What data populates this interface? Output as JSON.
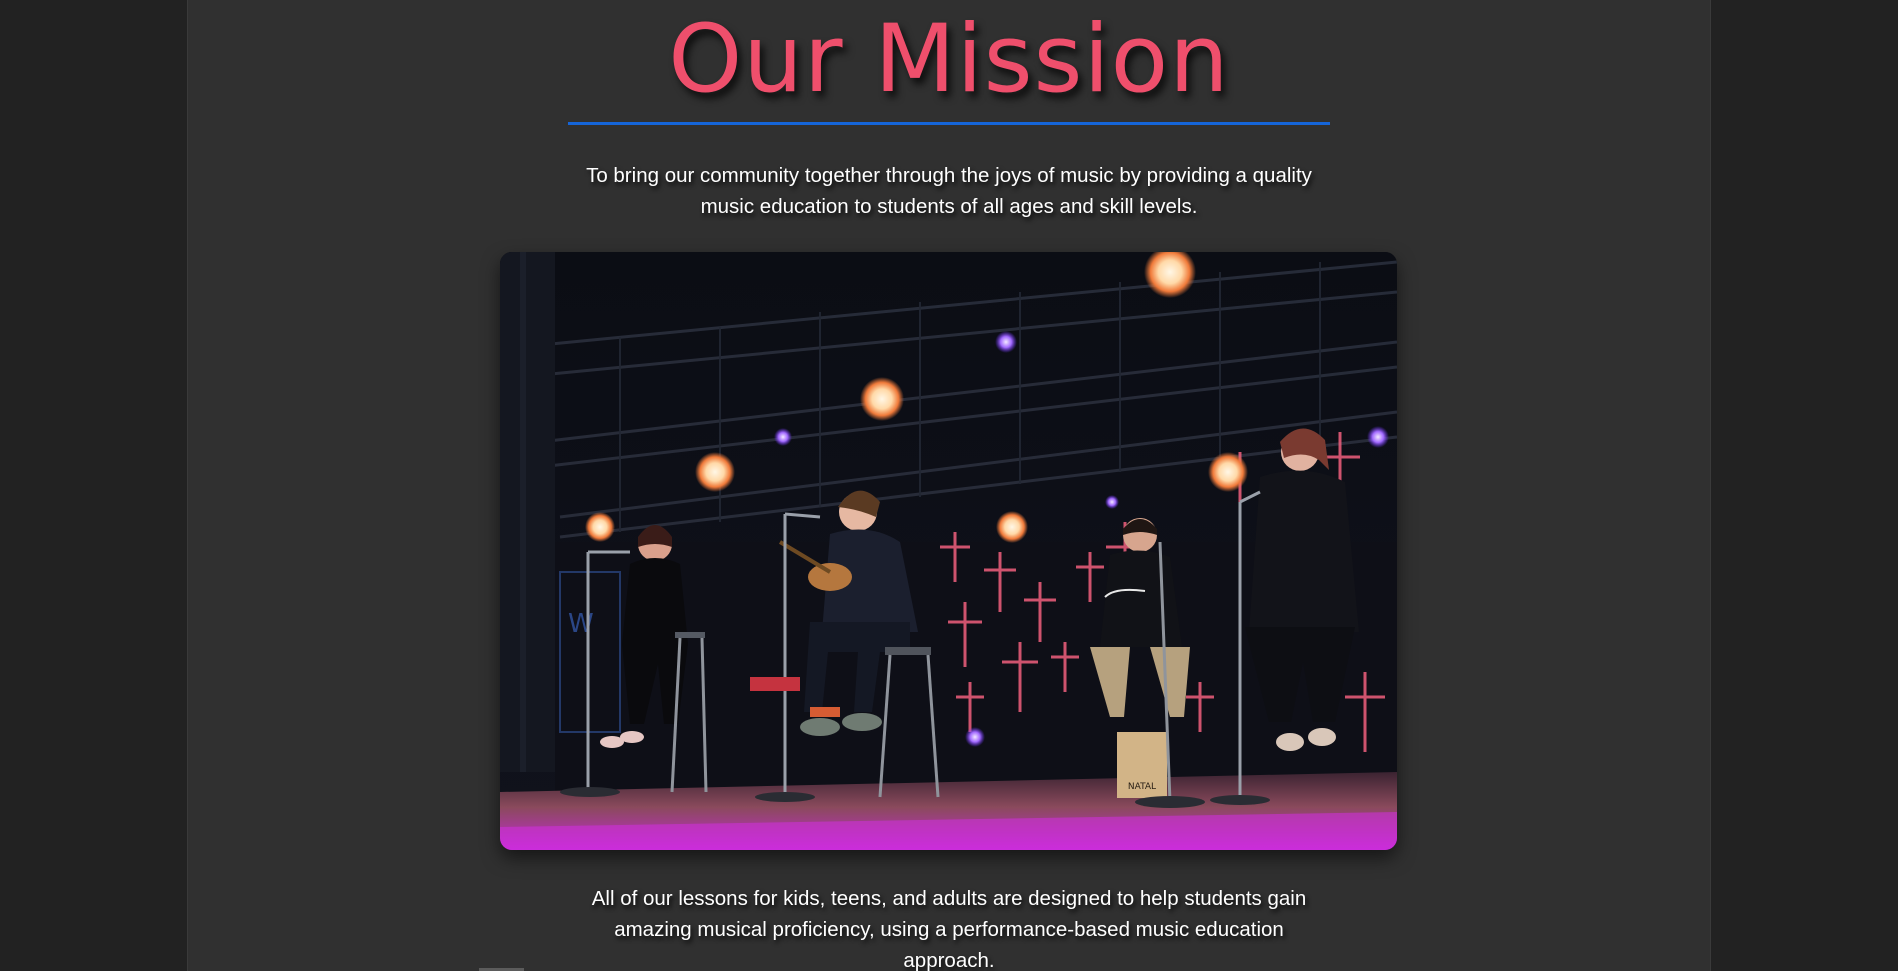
{
  "mission": {
    "title": "Our Mission",
    "lead": "To bring our community together through the joys of music by providing a quality music education to students of all ages and skill levels.",
    "body": "All of our lessons for kids, teens, and adults are designed to help students gain amazing musical proficiency, using a performance-based music education approach."
  },
  "colors": {
    "title": "#ef4f6c",
    "divider": "#1565d8",
    "page_background": "#303030",
    "outer_background": "#222222",
    "text": "#ffffff"
  },
  "photo": {
    "drum_label": "NATAL"
  }
}
